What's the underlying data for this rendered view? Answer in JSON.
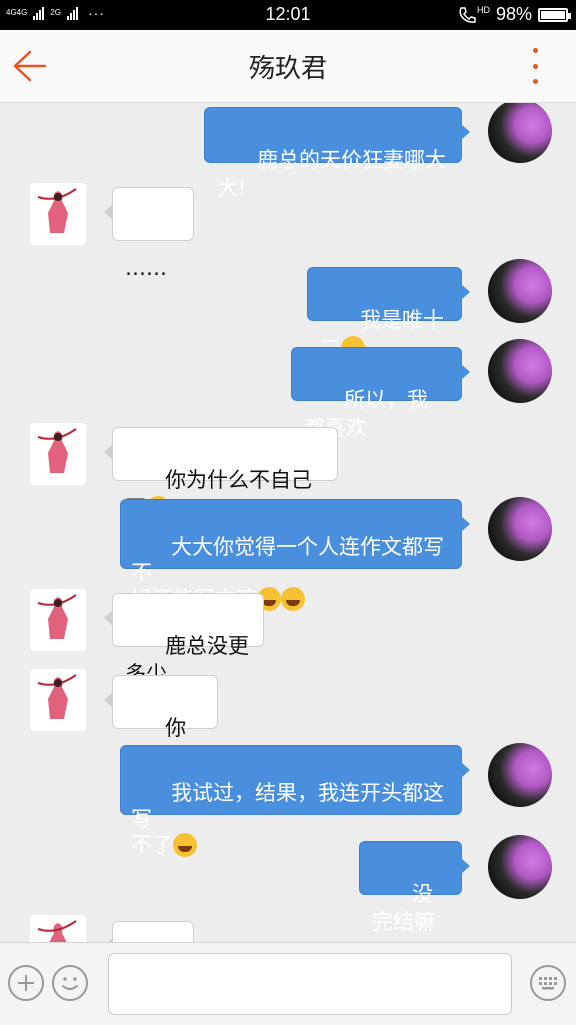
{
  "status_bar": {
    "signal_1": "4G4G",
    "signal_2": "2G",
    "dots": "···",
    "time": "12:01",
    "hd": "HD",
    "battery": "98%",
    "battery_level": 0.98
  },
  "header": {
    "title": "殇玖君"
  },
  "messages": [
    {
      "from": "me",
      "text": "鹿总的天价狂妻哪大大!"
    },
    {
      "from": "other",
      "text": "……"
    },
    {
      "from": "me",
      "text": "我是唯十二"
    },
    {
      "from": "me",
      "text": "所以，我都喜欢"
    },
    {
      "from": "other",
      "text": "你为什么不自己写"
    },
    {
      "from": "me",
      "text": "大大你觉得一个人连作文都写不\n好还能写文嘛"
    },
    {
      "from": "other",
      "text": "鹿总没更多少"
    },
    {
      "from": "other",
      "text": "你确定?"
    },
    {
      "from": "me",
      "text": "我试过，结果，我连开头都这写\n不了"
    },
    {
      "from": "me",
      "text": "没完结嘛"
    }
  ],
  "input": {
    "value": "",
    "placeholder": ""
  },
  "colors": {
    "accent": "#e8542a",
    "bubble_me": "#4a8fde",
    "bubble_other": "#ffffff"
  }
}
